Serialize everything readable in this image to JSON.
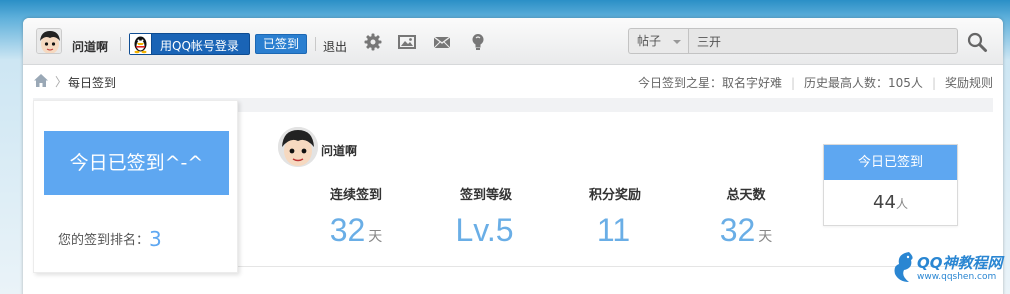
{
  "topbar": {
    "username": "问道啊",
    "qq_login_label": "用QQ帐号登录",
    "signed_label": "已签到",
    "logout_label": "退出",
    "icons": [
      "gear-icon",
      "image-icon",
      "mail-icon",
      "bulb-icon"
    ],
    "search": {
      "scope": "帖子",
      "value": "三开"
    }
  },
  "breadcrumb": {
    "current": "每日签到"
  },
  "header_stats": {
    "star": "今日签到之星：取名字好难",
    "max_count": "历史最高人数：105人",
    "rules": "奖励规则"
  },
  "signin": {
    "button_label": "今日已签到^-^",
    "rank_label": "您的签到排名：",
    "rank_value": "3"
  },
  "user": {
    "name": "问道啊"
  },
  "stats": [
    {
      "label": "连续签到",
      "value": "32",
      "unit": "天"
    },
    {
      "label": "签到等级",
      "value": "Lv.5",
      "unit": ""
    },
    {
      "label": "积分奖励",
      "value": "11",
      "unit": ""
    },
    {
      "label": "总天数",
      "value": "32",
      "unit": "天"
    }
  ],
  "today": {
    "title": "今日已签到",
    "count": "44",
    "unit": "人"
  },
  "watermark": {
    "name": "QQ神教程网",
    "url": "www.qqshen.com"
  },
  "colors": {
    "accent": "#5ea7f1",
    "stat_value": "#6aaee6",
    "qq_login_bg": "#1a64b6"
  }
}
